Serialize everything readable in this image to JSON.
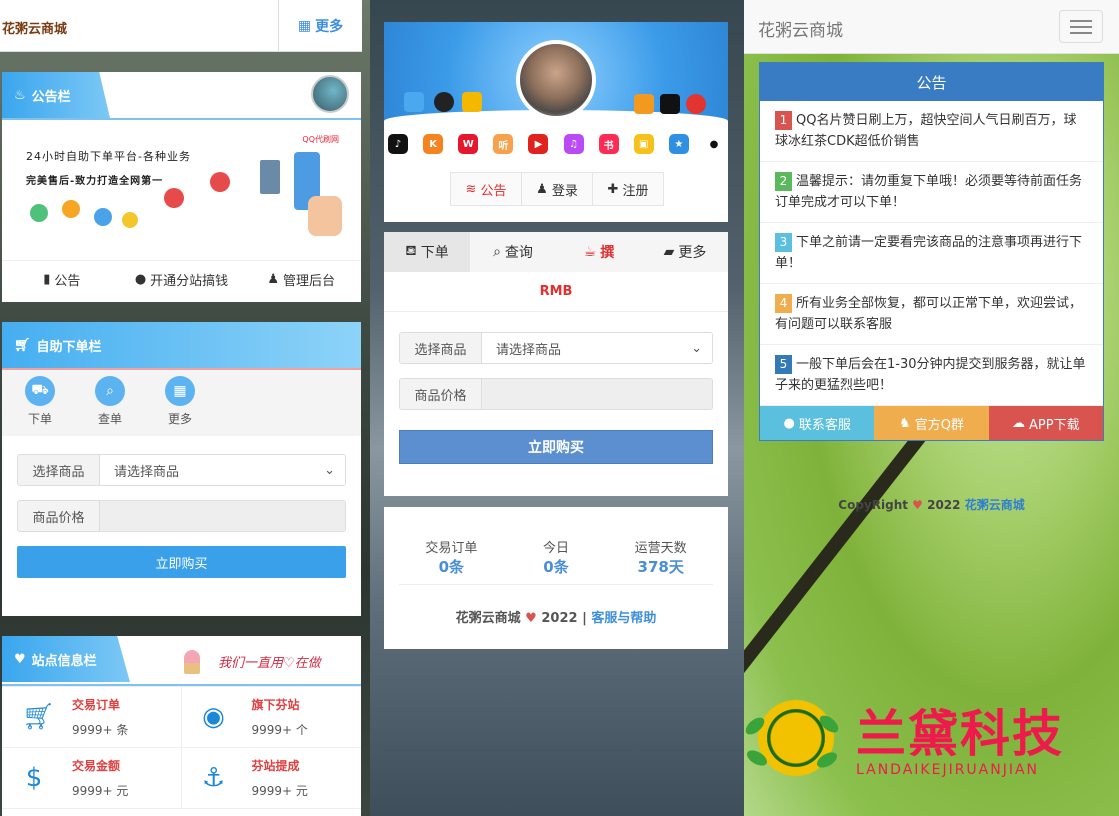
{
  "left": {
    "brand": "花粥云商城",
    "more": "更多",
    "notice_title": "公告栏",
    "banner_line1": "24小时自助下单平台-各种业务",
    "banner_line2": "完美售后-致力打造全网第一",
    "banner_logo": "QQ代刷网",
    "links": [
      "公告",
      "开通分站搞钱",
      "管理后台"
    ],
    "order_title": "自助下单栏",
    "tabs": [
      "下单",
      "查单",
      "更多"
    ],
    "select_label": "选择商品",
    "select_value": "请选择商品",
    "price_label": "商品价格",
    "buy": "立即购买",
    "info_title": "站点信息栏",
    "slogan": "我们一直用♡在做",
    "stats": [
      {
        "label": "交易订单",
        "value": "9999+ 条",
        "icon": "cart-icon"
      },
      {
        "label": "旗下芬站",
        "value": "9999+ 个",
        "icon": "globe-icon"
      },
      {
        "label": "交易金额",
        "value": "9999+ 元",
        "icon": "dollar-icon"
      },
      {
        "label": "芬站提成",
        "value": "9999+ 元",
        "icon": "anchor-icon"
      }
    ],
    "colors": {
      "accent": "#3aa6ee",
      "red": "#e04040"
    }
  },
  "middle": {
    "nav": [
      "公告",
      "登录",
      "注册"
    ],
    "tabs": [
      "下单",
      "查询",
      "撰",
      "更多"
    ],
    "rmb": "RMB",
    "select_label": "选择商品",
    "select_value": "请选择商品",
    "price_label": "商品价格",
    "buy": "立即购买",
    "stats": [
      {
        "label": "交易订单",
        "value": "0条"
      },
      {
        "label": "今日",
        "value": "0条"
      },
      {
        "label": "运营天数",
        "value": "378天"
      }
    ],
    "footer_brand": "花粥云商城",
    "footer_year": "2022",
    "footer_link": "客服与帮助"
  },
  "right": {
    "brand": "花粥云商城",
    "notice_title": "公告",
    "items": [
      {
        "n": "1",
        "color": "#d9534f",
        "text": "QQ名片赞日刷上万，超快空间人气日刷百万，球球冰红茶CDK超低价销售"
      },
      {
        "n": "2",
        "color": "#5cb85c",
        "text": "温馨提示：请勿重复下单哦！必须要等待前面任务订单完成才可以下单！"
      },
      {
        "n": "3",
        "color": "#5bc0de",
        "text": "下单之前请一定要看完该商品的注意事项再进行下单！"
      },
      {
        "n": "4",
        "color": "#f0ad4e",
        "text": "所有业务全部恢复，都可以正常下单，欢迎尝试，有问题可以联系客服"
      },
      {
        "n": "5",
        "color": "#337ab7",
        "text": "一般下单后会在1-30分钟内提交到服务器，就让单子来的更猛烈些吧！"
      }
    ],
    "buttons": [
      {
        "label": "联系客服",
        "color": "#5bc0de"
      },
      {
        "label": "官方Q群",
        "color": "#f0ad4e"
      },
      {
        "label": "APP下载",
        "color": "#d9534f"
      }
    ],
    "copyright_prefix": "CopyRight",
    "copyright_year": "2022",
    "copyright_link": "花粥云商城",
    "watermark_cn": "兰黛科技",
    "watermark_en": "LANDAIKEJIRUANJIAN"
  }
}
